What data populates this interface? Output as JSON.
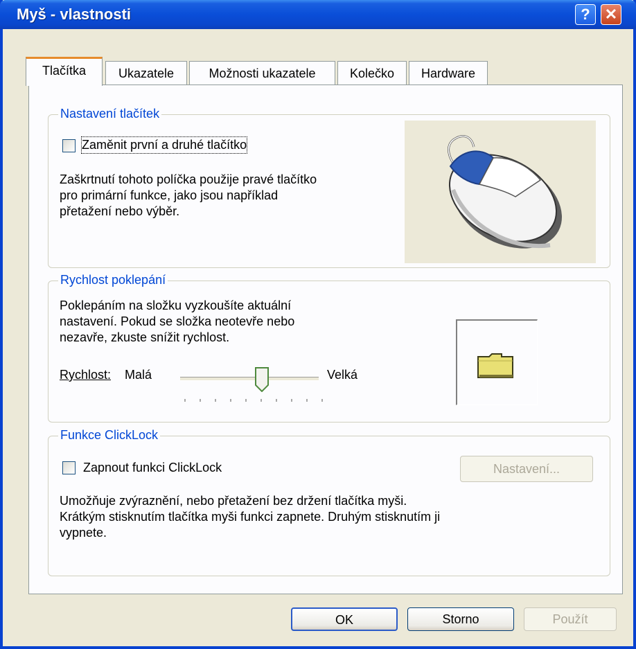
{
  "window": {
    "title": "Myš - vlastnosti",
    "help_label": "?",
    "close_label": "✕"
  },
  "tabs": [
    {
      "label": "Tlačítka",
      "active": true
    },
    {
      "label": "Ukazatele",
      "active": false
    },
    {
      "label": "Možnosti ukazatele",
      "active": false
    },
    {
      "label": "Kolečko",
      "active": false
    },
    {
      "label": "Hardware",
      "active": false
    }
  ],
  "button_config": {
    "legend": "Nastavení tlačítek",
    "swap_checkbox": {
      "label": "Zaměnit první a druhé tlačítko",
      "checked": false
    },
    "description": "Zaškrtnutí tohoto políčka použije pravé tlačítko pro primární funkce, jako jsou například přetažení nebo výběr.",
    "description_lines": [
      "Zaškrtnutí tohoto políčka použije pravé tlačítko",
      "pro primární funkce, jako jsou například",
      "přetažení nebo výběr."
    ],
    "image_icon": "mouse-icon"
  },
  "double_click": {
    "legend": "Rychlost poklepání",
    "description_lines": [
      "Poklepáním na složku vyzkoušíte aktuální",
      "nastavení. Pokud se složka neotevře nebo",
      "nezavře, zkuste snížit rychlost."
    ],
    "speed_label": "Rychlost:",
    "min_label": "Malá",
    "max_label": "Velká",
    "slider_value": 0.5,
    "test_icon": "folder-icon"
  },
  "clicklock": {
    "legend": "Funkce ClickLock",
    "checkbox": {
      "label": "Zapnout funkci ClickLock",
      "checked": false
    },
    "settings_button": "Nastavení...",
    "description_lines": [
      "Umožňuje zvýraznění, nebo přetažení bez držení tlačítka myši.",
      "Krátkým stisknutím tlačítka myši funkci zapnete. Druhým stisknutím ji",
      "vypnete."
    ]
  },
  "footer": {
    "ok": "OK",
    "cancel": "Storno",
    "apply": "Použít"
  },
  "colors": {
    "titlebar": "#0a4ed8",
    "accent": "#0046d5",
    "tab_highlight": "#e68b2c",
    "dialog_bg": "#ece9d8"
  }
}
